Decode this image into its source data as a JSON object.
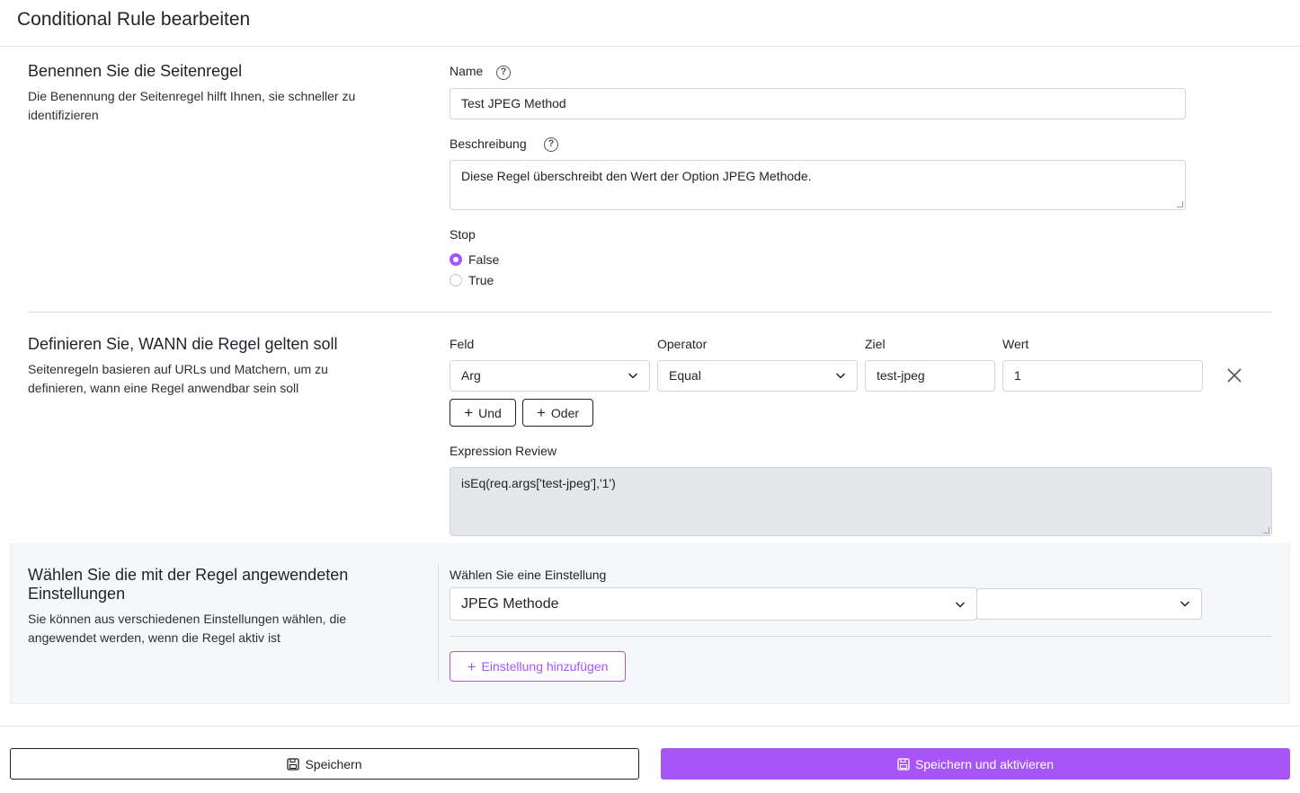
{
  "header": {
    "title": "Conditional Rule bearbeiten"
  },
  "naming": {
    "title": "Benennen Sie die Seitenregel",
    "description": "Die Benennung der Seitenregel hilft Ihnen, sie schneller zu identifizieren",
    "name_label": "Name",
    "name_value": "Test JPEG Method",
    "description_label": "Beschreibung",
    "description_value": "Diese Regel überschreibt den Wert der Option JPEG Methode.",
    "stop_label": "Stop",
    "stop_options": [
      {
        "label": "False",
        "checked": true
      },
      {
        "label": "True",
        "checked": false
      }
    ]
  },
  "conditions": {
    "title": "Definieren Sie, WANN die Regel gelten soll",
    "description": "Seitenregeln basieren auf URLs und Matchern, um zu definieren, wann eine Regel anwendbar sein soll",
    "field_label": "Feld",
    "operator_label": "Operator",
    "target_label": "Ziel",
    "value_label": "Wert",
    "field_value": "Arg",
    "operator_value": "Equal",
    "target_value": "test-jpeg",
    "value_value": "1",
    "and_label": "Und",
    "or_label": "Oder",
    "expression_label": "Expression Review",
    "expression_value": "isEq(req.args['test-jpeg'],'1')"
  },
  "settings": {
    "title": "Wählen Sie die mit der Regel angewendeten Einstellungen",
    "description": "Sie können aus verschiedenen Einstellungen wählen, die angewendet werden, wenn die Regel aktiv ist",
    "select_label": "Wählen Sie eine Einstellung",
    "setting_value": "JPEG Methode",
    "setting_option_value": "",
    "add_label": "Einstellung hinzufügen"
  },
  "footer": {
    "save_label": "Speichern",
    "save_activate_label": "Speichern und aktivieren"
  },
  "colors": {
    "accent": "#a855f7",
    "readonly_bg": "#e5e7eb",
    "panel_bg": "#f6f7f9"
  }
}
